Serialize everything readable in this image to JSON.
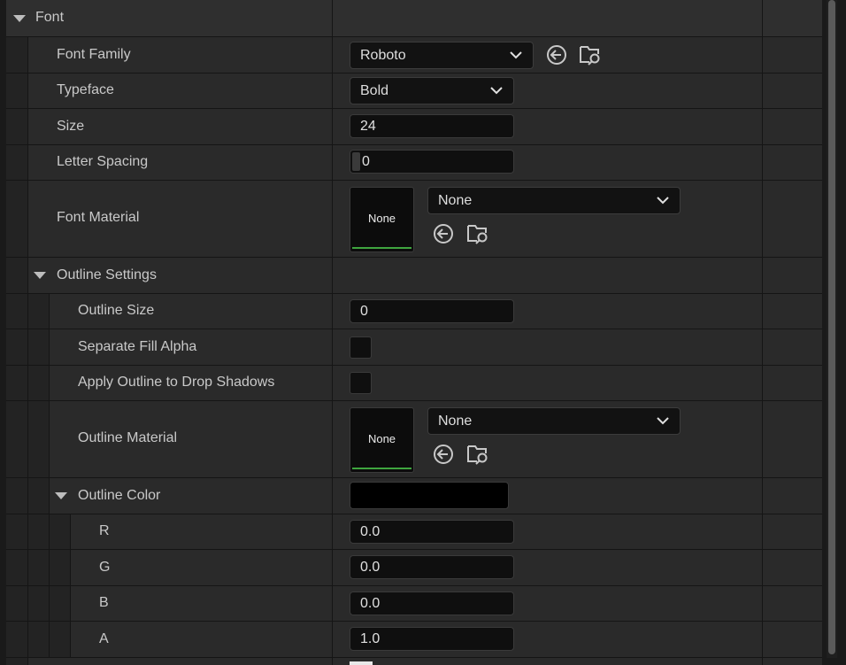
{
  "font_section": {
    "header": "Font",
    "font_family": {
      "label": "Font Family",
      "value": "Roboto"
    },
    "typeface": {
      "label": "Typeface",
      "value": "Bold"
    },
    "size": {
      "label": "Size",
      "value": "24"
    },
    "letter_spacing": {
      "label": "Letter Spacing",
      "value": "0"
    },
    "font_material": {
      "label": "Font Material",
      "thumb_label": "None",
      "value": "None"
    }
  },
  "outline_settings": {
    "header": "Outline Settings",
    "outline_size": {
      "label": "Outline Size",
      "value": "0"
    },
    "separate_fill_alpha": {
      "label": "Separate Fill Alpha",
      "checked": false
    },
    "apply_outline_drop_shadows": {
      "label": "Apply Outline to Drop Shadows",
      "checked": false
    },
    "outline_material": {
      "label": "Outline Material",
      "thumb_label": "None",
      "value": "None"
    },
    "outline_color": {
      "label": "Outline Color",
      "swatch_color": "#000000",
      "r": {
        "label": "R",
        "value": "0.0"
      },
      "g": {
        "label": "G",
        "value": "0.0"
      },
      "b": {
        "label": "B",
        "value": "0.0"
      },
      "a": {
        "label": "A",
        "value": "1.0"
      }
    }
  },
  "icons": {
    "use_selected": "arrow-left-circle-icon",
    "browse": "folder-search-icon",
    "dropdown": "chevron-down-icon"
  },
  "colors": {
    "material_bar": "#3fa53f"
  }
}
